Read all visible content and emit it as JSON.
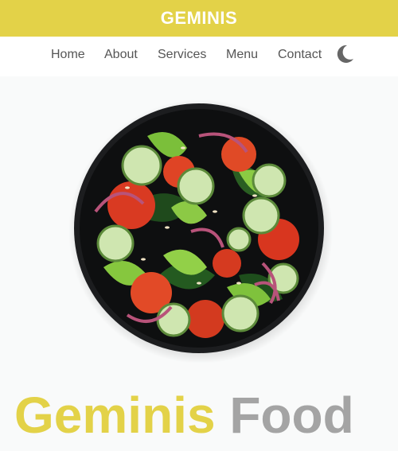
{
  "header": {
    "brand": "GEMINIS"
  },
  "nav": {
    "links": [
      "Home",
      "About",
      "Services",
      "Menu",
      "Contact"
    ],
    "theme_toggle_icon": "moon-icon"
  },
  "hero": {
    "image": "salad-bowl-image",
    "headline_part1": "Geminis",
    "headline_part2": "Food"
  },
  "colors": {
    "accent": "#e3d248",
    "muted_text": "#a4a4a4",
    "nav_text": "#555555",
    "background": "#f9fafa"
  }
}
